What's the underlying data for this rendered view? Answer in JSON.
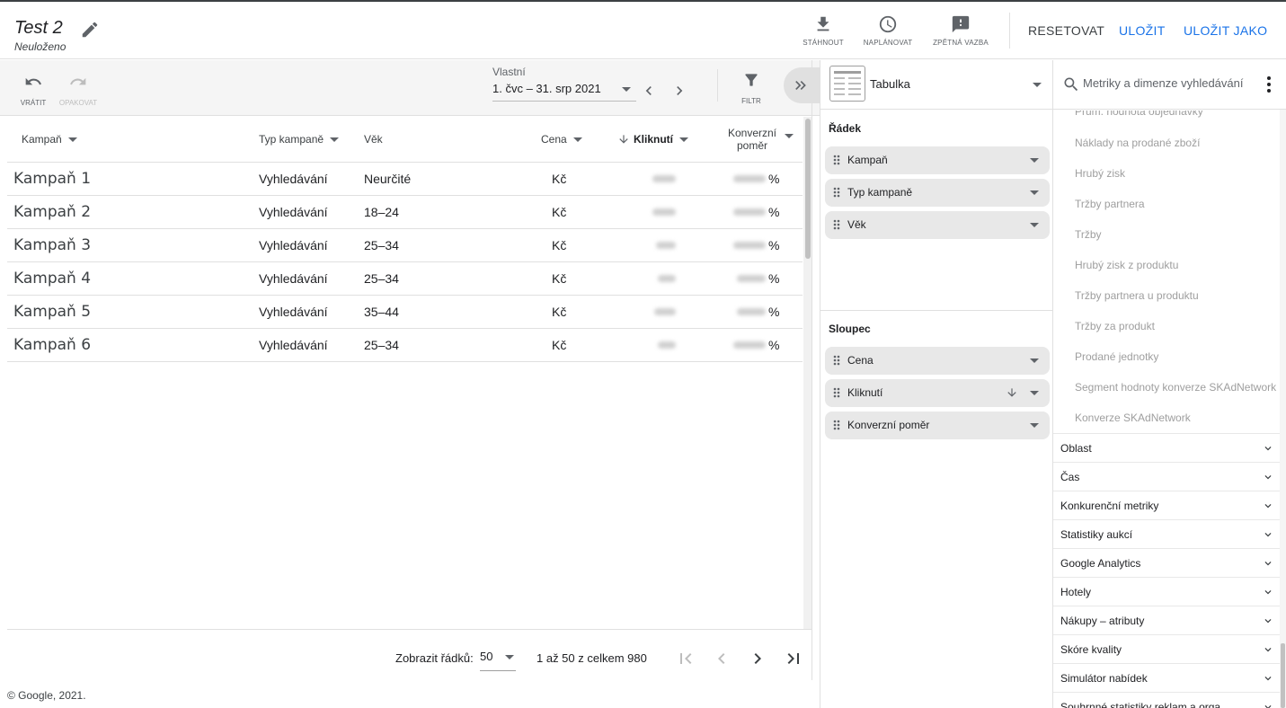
{
  "report": {
    "title": "Test 2",
    "status": "Neuloženo"
  },
  "header_actions": [
    {
      "label": "STÁHNOUT",
      "icon": "download-icon"
    },
    {
      "label": "NAPLÁNOVAT",
      "icon": "schedule-icon"
    },
    {
      "label": "ZPĚTNÁ VAZBA",
      "icon": "feedback-icon"
    }
  ],
  "header_buttons": {
    "reset": "RESETOVAT",
    "save": "ULOŽIT",
    "save_as": "ULOŽIT JAKO"
  },
  "toolbar": {
    "undo": "VRÁTIT",
    "redo": "OPAKOVAT",
    "date_label": "Vlastní",
    "date_range": "1. čvc – 31. srp 2021",
    "filter": "FILTR"
  },
  "table": {
    "columns": [
      "Kampaň",
      "Typ kampaně",
      "Věk",
      "Cena",
      "Kliknutí",
      "Konverzní poměr"
    ],
    "rows": [
      {
        "campaign": "Kampaň 1",
        "type": "Vyhledávání",
        "age": "Neurčité",
        "cost": "Kč",
        "conv": "%"
      },
      {
        "campaign": "Kampaň 2",
        "type": "Vyhledávání",
        "age": "18–24",
        "cost": "Kč",
        "conv": "%"
      },
      {
        "campaign": "Kampaň 3",
        "type": "Vyhledávání",
        "age": "25–34",
        "cost": "Kč",
        "conv": "%"
      },
      {
        "campaign": "Kampaň 4",
        "type": "Vyhledávání",
        "age": "25–34",
        "cost": "Kč",
        "conv": "%"
      },
      {
        "campaign": "Kampaň 5",
        "type": "Vyhledávání",
        "age": "35–44",
        "cost": "Kč",
        "conv": "%"
      },
      {
        "campaign": "Kampaň 6",
        "type": "Vyhledávání",
        "age": "25–34",
        "cost": "Kč",
        "conv": "%"
      }
    ]
  },
  "pagination": {
    "label": "Zobrazit řádků:",
    "rows_per_page": "50",
    "range": "1 až 50 z celkem 980"
  },
  "footer": "© Google, 2021.",
  "editor": {
    "visualization": "Tabulka",
    "row_section": "Řádek",
    "row_chips": [
      "Kampaň",
      "Typ kampaně",
      "Věk"
    ],
    "column_section": "Sloupec",
    "column_chips": [
      "Cena",
      "Kliknutí",
      "Konverzní poměr"
    ]
  },
  "sidebar": {
    "search_placeholder": "Metriky a dimenze vyhledávání",
    "cut_item": "Prům. hodnota objednávky",
    "metric_items": [
      "Náklady na prodané zboží",
      "Hrubý zisk",
      "Tržby partnera",
      "Tržby",
      "Hrubý zisk z produktu",
      "Tržby partnera u produktu",
      "Tržby za produkt",
      "Prodané jednotky",
      "Segment hodnoty konverze SKAdNetwork",
      "Konverze SKAdNetwork"
    ],
    "categories": [
      "Oblast",
      "Čas",
      "Konkurenční metriky",
      "Statistiky aukcí",
      "Google Analytics",
      "Hotely",
      "Nákupy – atributy",
      "Skóre kvality",
      "Simulátor nabídek",
      "Souhrnné statistiky reklam a orga"
    ]
  }
}
